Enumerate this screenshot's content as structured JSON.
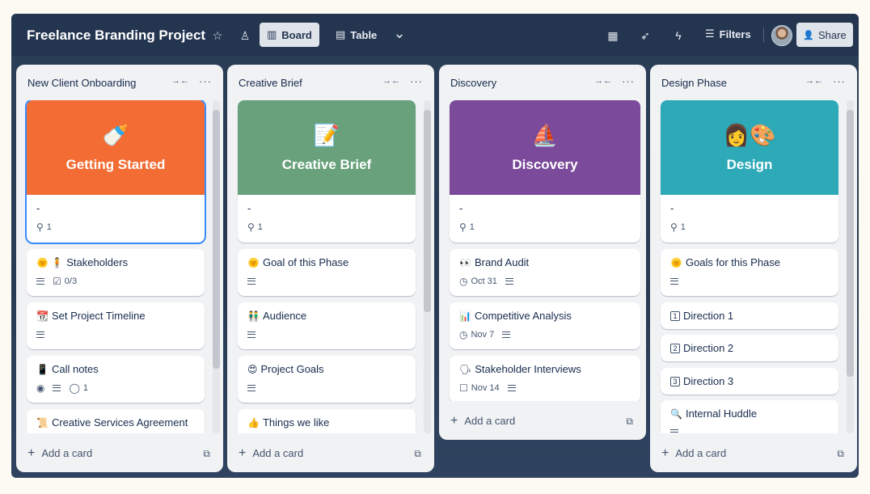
{
  "board": {
    "title": "Freelance Branding Project",
    "views": [
      {
        "label": "Board",
        "icon": "board-icon",
        "active": true
      },
      {
        "label": "Table",
        "icon": "table-icon",
        "active": false
      }
    ],
    "filters_label": "Filters",
    "share_label": "Share"
  },
  "icons": {
    "star": "☆",
    "workspace": "♙",
    "board": "▥",
    "table": "▤",
    "chevron": "⌄",
    "calendar": "▦",
    "rocket": "➶",
    "lightning": "ϟ",
    "filter": "☰",
    "share": "👤",
    "collapse": "→←",
    "more": "···",
    "attachment": "⚲",
    "checklist": "☑",
    "clock": "◷",
    "eye": "◉",
    "comment": "◯",
    "checkbox": "☐",
    "plus": "+",
    "template": "⧉"
  },
  "colors": {
    "board_bg": "#2b3e57",
    "topbar": "#243550",
    "getting_started": "#f26c33",
    "creative_brief": "#68a17c",
    "discovery": "#7b4a9a",
    "design": "#2ea9b7",
    "focus": "#388bff"
  },
  "lists": [
    {
      "title": "New Client Onboarding",
      "add_label": "Add a card",
      "cards": [
        {
          "cover_title": "Getting Started",
          "cover_emoji": "🍼",
          "title": "-",
          "attachments": "1"
        },
        {
          "emoji": "🌞 🧍",
          "title": "Stakeholders",
          "checklist": "0/3"
        },
        {
          "emoji": "📆",
          "title": "Set Project Timeline"
        },
        {
          "emoji": "📱",
          "title": "Call notes",
          "comments": "1"
        },
        {
          "emoji": "📜",
          "title": "Creative Services Agreement"
        }
      ]
    },
    {
      "title": "Creative Brief",
      "add_label": "Add a card",
      "cards": [
        {
          "cover_title": "Creative Brief",
          "cover_emoji": "📝",
          "title": "-",
          "attachments": "1"
        },
        {
          "emoji": "🌞",
          "title": "Goal of this Phase"
        },
        {
          "emoji": "👬",
          "title": "Audience"
        },
        {
          "emoji": "😍",
          "title": "Project Goals"
        },
        {
          "emoji": "👍",
          "title": "Things we like"
        }
      ]
    },
    {
      "title": "Discovery",
      "add_label": "Add a card",
      "cards": [
        {
          "cover_title": "Discovery",
          "cover_emoji": "⛵",
          "title": "-",
          "attachments": "1"
        },
        {
          "emoji": "👀",
          "title": "Brand Audit",
          "due": "Oct 31"
        },
        {
          "emoji": "📊",
          "title": "Competitive Analysis",
          "due": "Nov 7"
        },
        {
          "emoji": "🗣",
          "title": "Stakeholder Interviews",
          "due": "Nov 14"
        }
      ]
    },
    {
      "title": "Design Phase",
      "add_label": "Add a card",
      "cards": [
        {
          "cover_title": "Design",
          "cover_emoji": "👩🎨",
          "title": "-",
          "attachments": "1"
        },
        {
          "emoji": "🌞",
          "title": "Goals for this Phase"
        },
        {
          "num": "1",
          "title": "Direction 1"
        },
        {
          "num": "2",
          "title": "Direction 2"
        },
        {
          "num": "3",
          "title": "Direction 3"
        },
        {
          "emoji": "🔍",
          "title": "Internal Huddle"
        }
      ]
    }
  ]
}
